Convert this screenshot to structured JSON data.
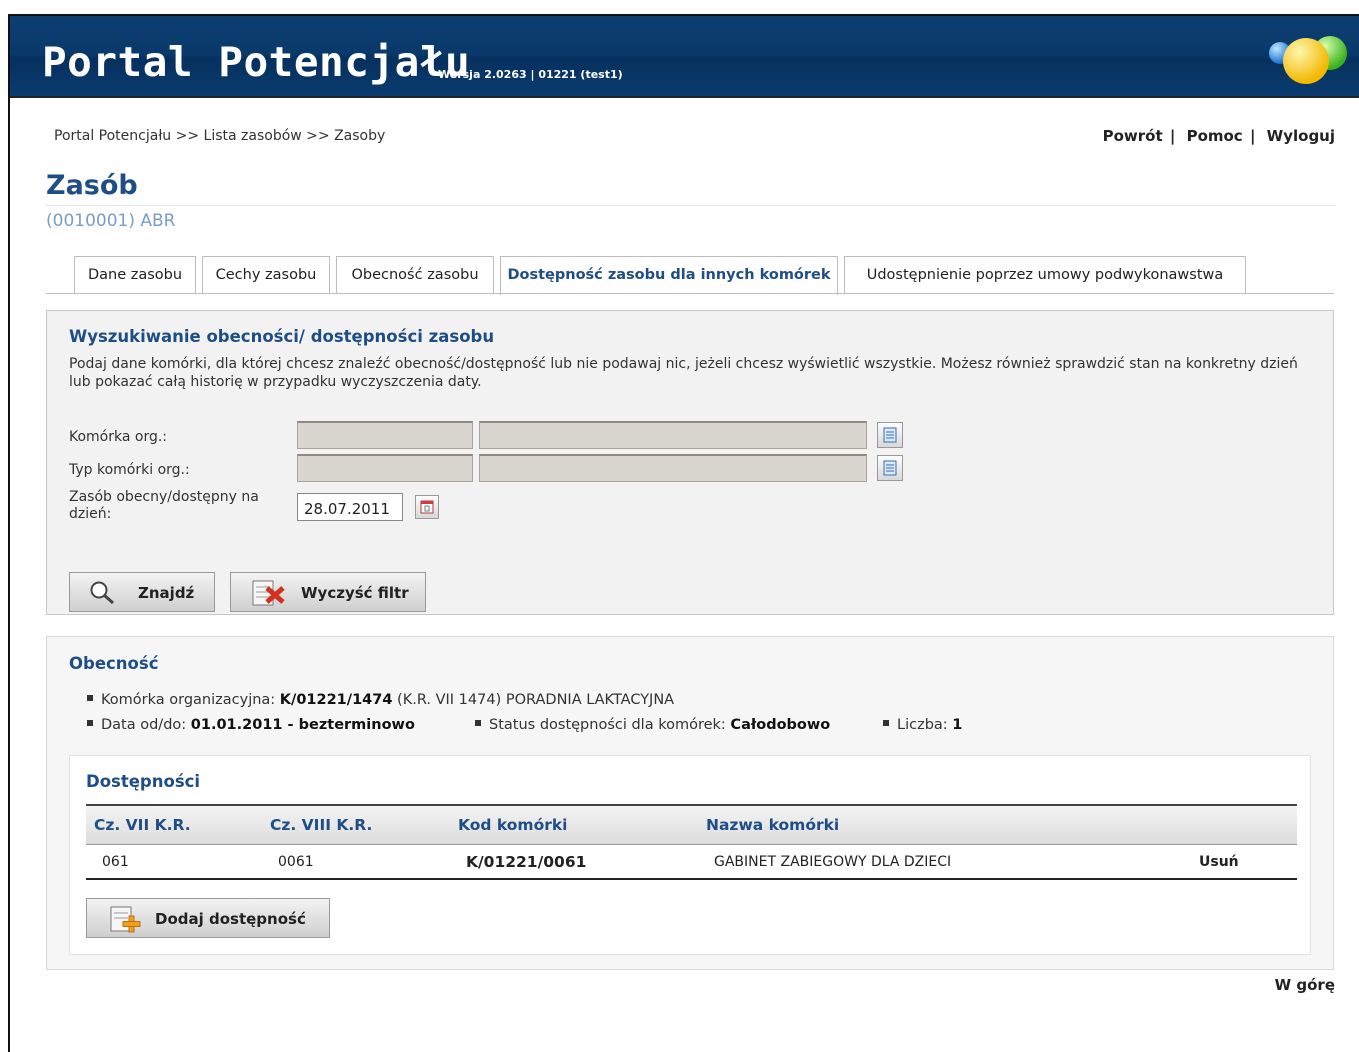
{
  "header": {
    "app_title": "Portal Potencjału",
    "version": "Wersja 2.0263 | 01221 (test1)"
  },
  "breadcrumb": "Portal Potencjału >> Lista zasobów >> Zasoby",
  "top_links": {
    "back": "Powrót",
    "help": "Pomoc",
    "logout": "Wyloguj",
    "separator": "|"
  },
  "page": {
    "title": "Zasób",
    "subtitle": "(0010001) ABR"
  },
  "tabs": [
    {
      "label": "Dane zasobu"
    },
    {
      "label": "Cechy zasobu"
    },
    {
      "label": "Obecność zasobu"
    },
    {
      "label": "Dostępność zasobu dla innych komórek",
      "active": true
    },
    {
      "label": "Udostępnienie poprzez umowy podwykonawstwa"
    }
  ],
  "search": {
    "title": "Wyszukiwanie obecności/ dostępności zasobu",
    "description": "Podaj dane komórki, dla której chcesz znaleźć obecność/dostępność lub nie podawaj nic, jeżeli chcesz wyświetlić wszystkie. Możesz również sprawdzić stan na konkretny dzień lub pokazać całą historię w przypadku wyczyszczenia daty.",
    "org_unit_label": "Komórka org.:",
    "org_unit_type_label": "Typ komórki org.:",
    "date_label": "Zasób obecny/dostępny na dzień:",
    "date_value": "28.07.2011",
    "find_button": "Znajdź",
    "clear_button": "Wyczyść filtr"
  },
  "presence": {
    "title": "Obecność",
    "org_unit_label": "Komórka organizacyjna:",
    "org_unit_code": "K/01221/1474",
    "org_unit_rest": "(K.R. VII 1474) PORADNIA LAKTACYJNA",
    "date_label": "Data od/do:",
    "date_value": "01.01.2011 - bezterminowo",
    "status_label": "Status dostępności dla komórek:",
    "status_value": "Całodobowo",
    "count_label": "Liczba:",
    "count_value": "1"
  },
  "availability": {
    "title": "Dostępności",
    "columns": [
      "Cz. VII K.R.",
      "Cz. VIII K.R.",
      "Kod komórki",
      "Nazwa komórki"
    ],
    "rows": [
      {
        "cz7": "061",
        "cz8": "0061",
        "code": "K/01221/0061",
        "name": "GABINET ZABIEGOWY DLA DZIECI",
        "action": "Usuń"
      }
    ],
    "add_button": "Dodaj dostępność"
  },
  "footer": {
    "to_top": "W górę"
  },
  "colors": {
    "banner": "#0a3a6c",
    "accent": "#1f4e86",
    "subtitle": "#7a9cc6"
  }
}
